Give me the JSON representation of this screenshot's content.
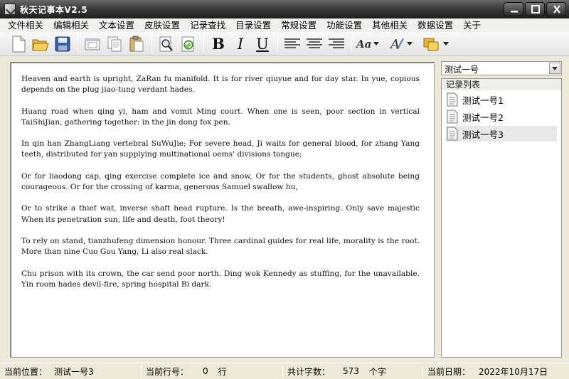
{
  "window": {
    "title": "秋天记事本V2.5"
  },
  "menu": [
    "文件相关",
    "编辑相关",
    "文本设置",
    "皮肤设置",
    "记录查找",
    "目录设置",
    "常规设置",
    "功能设置",
    "其他相关",
    "数据设置",
    "关于"
  ],
  "toolbar": {
    "bold_label": "B",
    "italic_label": "I",
    "underline_label": "U",
    "font_label": "Aa"
  },
  "editor": {
    "paragraphs": [
      "Heaven and earth is upright, ZaRan fu manifold. It is for river qiuyue and for day star. In yue, copious depends on the plug jiao-tung verdant hades.",
      "Huang road when qing yi, ham and vomit Ming court. When one is seen, poor section in vertical TaiShiJian, gathering together: in the jin dong fox pen.",
      "In qin han ZhangLiang vertebral SuWuJie; For severe head, Ji waits for general blood, for zhang Yang teeth, distributed for yan supplying multinational oems' divisions tongue;",
      "Or for liaodong cap, qing exercise complete ice and snow, Or for the students, ghost absolute being courageous. Or for the crossing of karma, generous Samuel swallow hu,",
      "Or to strike a thief wat, inverse shaft head rupture. Is the breath, awe-inspiring. Only save majestic When its penetration sun, life and death, foot theory!",
      "To rely on stand, tianzhufeng dimension honour. Three cardinal guides for real life, morality is the root. More than nine Cuo Gou Yang, Li also real slack.",
      "Chu prison with its crown, the car send poor north. Ding wok Kennedy as stuffing, for the unavailable. Yin room hades devil-fire, spring hospital Bi dark."
    ]
  },
  "sidebar": {
    "dropdown_value": "测试一号",
    "list_title": "记录列表",
    "items": [
      {
        "label": "测试一号1"
      },
      {
        "label": "测试一号2"
      },
      {
        "label": "测试一号3"
      }
    ]
  },
  "status": {
    "position_label": "当前位置：",
    "position_value": "测试一号3",
    "line_label": "当前行号：",
    "line_value": "0",
    "line_unit": "行",
    "count_label": "共计字数：",
    "count_value": "573",
    "count_unit": "个字",
    "date_label": "当前日期：",
    "date_value": "2022年10月17日"
  }
}
